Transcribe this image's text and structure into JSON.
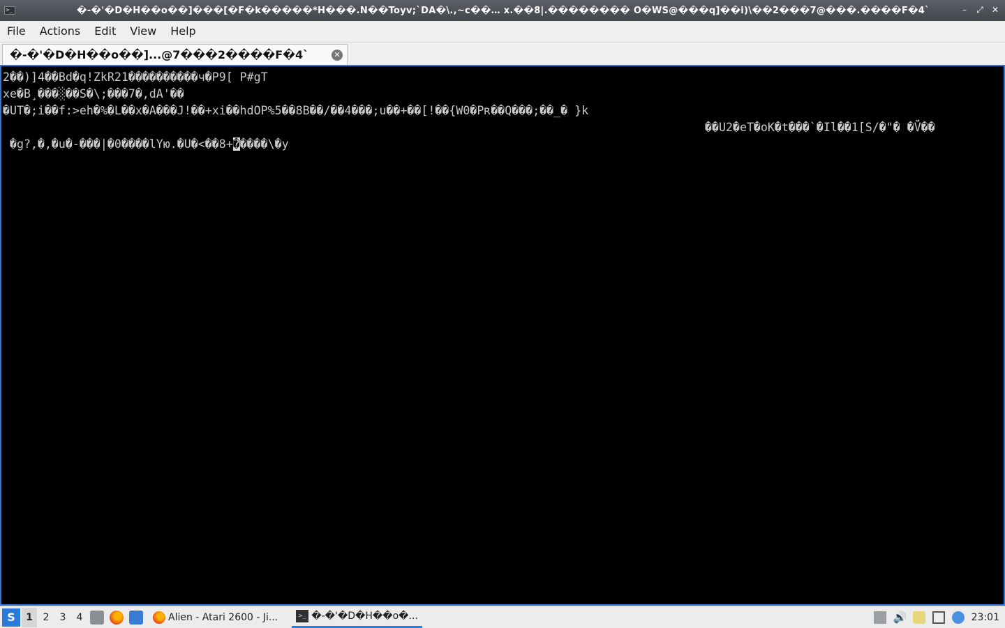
{
  "window": {
    "title": "�-�'�D�H��o��]���[�F�k�����*H���.N��Toyv;`DA�\\.,~c��…  x.��8|.�������� Ò�WS@���q]��i)\\��2���7@���.����F�4`"
  },
  "menu": [
    "File",
    "Actions",
    "Edit",
    "View",
    "Help"
  ],
  "tab": {
    "label": "�-�'�D�H��o��]...@7���2����F�4`"
  },
  "terminal": {
    "lines": [
      "2��)]4��Bd�q!ZkR21����������ч�P9[ P#gT",
      "xe�B¸���░��S�\\;���7�,dA'��",
      "�UT�;i��f:>eh�%�L��x�A���J!��+xi��hdOP%5��8B��/��4���;u��+��[!��{W0�Pʀ��Q���;��_� }k",
      "��U2�eT�oK�t���`�Il��1[S/�\"� �V̈́��",
      " �g?,�,�u�-���|�0����lYю.�U�<��8+",
      "����\\�y"
    ],
    "cursor_char": "�"
  },
  "taskbar": {
    "workspaces": [
      "1",
      "2",
      "3",
      "4"
    ],
    "active_workspace": "1",
    "tasks": [
      {
        "label": "Alien - Atari 2600 - Ji...",
        "icon": "firefox-icon"
      },
      {
        "label": "�-�'�D�H��o�...",
        "icon": "terminal-icon"
      }
    ],
    "clock": "23:01"
  },
  "colors": {
    "accent": "#2a7ad8",
    "terminal_bg": "#000000",
    "terminal_fg": "#c9c9c9"
  }
}
